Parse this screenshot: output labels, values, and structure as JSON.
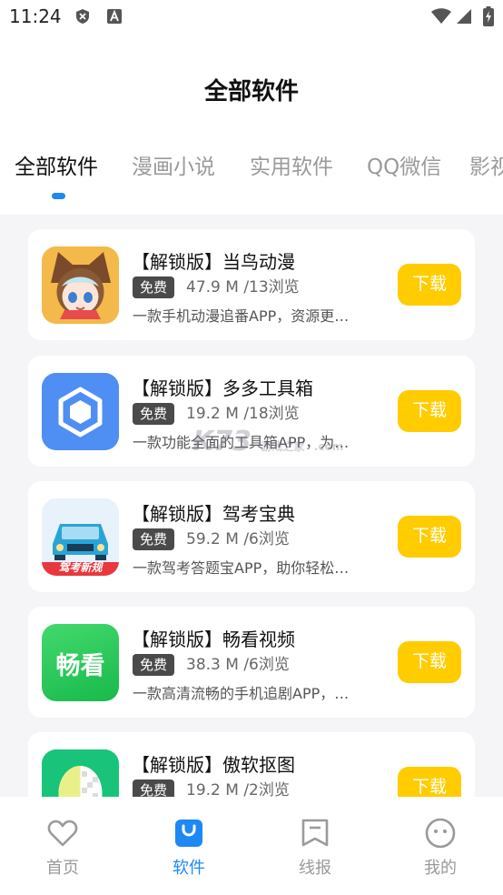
{
  "status_bar": {
    "time": "11:24"
  },
  "page_title": "全部软件",
  "tabs": [
    {
      "label": "全部软件",
      "active": true
    },
    {
      "label": "漫画小说",
      "active": false
    },
    {
      "label": "实用软件",
      "active": false
    },
    {
      "label": "QQ微信",
      "active": false
    },
    {
      "label": "影视",
      "active": false
    }
  ],
  "apps": [
    {
      "name": "【解锁版】当鸟动漫",
      "badge": "免费",
      "meta": "47.9 M /13浏览",
      "desc": "一款手机动漫追番APP，资源更…",
      "button": "下载",
      "icon": "anime-girl-icon"
    },
    {
      "name": "【解锁版】多多工具箱",
      "badge": "免费",
      "meta": "19.2 M /18浏览",
      "desc": "一款功能全面的工具箱APP，为…",
      "button": "下载",
      "icon": "toolbox-hexagon-icon"
    },
    {
      "name": "【解锁版】驾考宝典",
      "badge": "免费",
      "meta": "59.2 M /6浏览",
      "desc": "一款驾考答题宝APP，助你轻松…",
      "button": "下载",
      "icon": "car-icon",
      "icon_banner": "驾考新规"
    },
    {
      "name": "【解锁版】畅看视频",
      "badge": "免费",
      "meta": "38.3 M /6浏览",
      "desc": "一款高清流畅的手机追剧APP，…",
      "button": "下载",
      "icon": "changkan-icon",
      "icon_text": "畅看"
    },
    {
      "name": "【解锁版】傲软抠图",
      "badge": "免费",
      "meta": "19.2 M /2浏览",
      "desc": "",
      "button": "下载",
      "icon": "cutout-icon"
    }
  ],
  "watermark": {
    "main": "K73",
    "sub": "游戏之家",
    "domain": ".com"
  },
  "bottom_nav": [
    {
      "label": "首页",
      "icon": "heart-icon",
      "active": false
    },
    {
      "label": "软件",
      "icon": "bag-icon",
      "active": true
    },
    {
      "label": "线报",
      "icon": "bookmark-icon",
      "active": false
    },
    {
      "label": "我的",
      "icon": "smile-icon",
      "active": false
    }
  ],
  "colors": {
    "accent": "#1e88f5",
    "download": "#ffcc00",
    "badge": "#4a4a4a"
  }
}
